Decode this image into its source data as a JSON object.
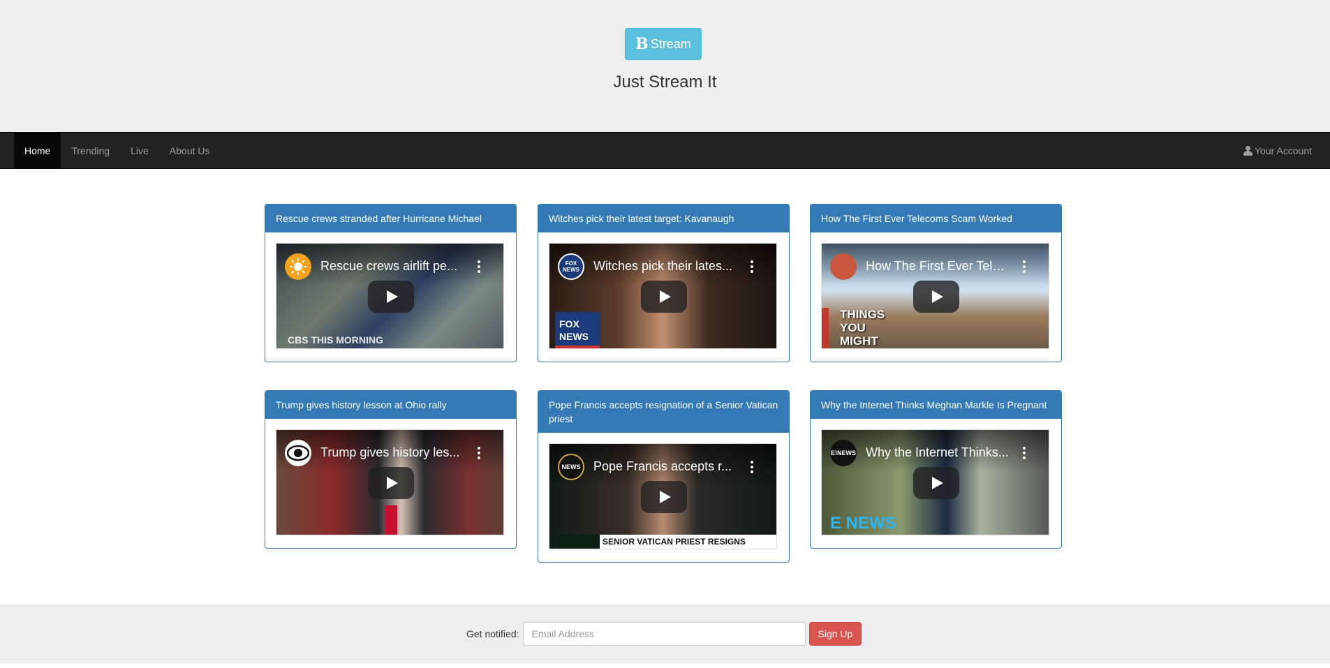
{
  "brand": {
    "logo_mark": "B",
    "logo_label": "Stream",
    "tagline": "Just Stream It"
  },
  "nav": {
    "items": [
      {
        "label": "Home",
        "active": true
      },
      {
        "label": "Trending",
        "active": false
      },
      {
        "label": "Live",
        "active": false
      },
      {
        "label": "About Us",
        "active": false
      }
    ],
    "account_label": "Your Account",
    "account_icon": "user-icon"
  },
  "videos": [
    {
      "heading": "Rescue crews stranded after Hurricane Michael",
      "embed_title": "Rescue crews airlift pe...",
      "channel_mark": "",
      "overlay": "CBS THIS MORNING"
    },
    {
      "heading": "Witches pick their latest target: Kavanaugh",
      "embed_title": "Witches pick their lates...",
      "channel_mark": "FOX NEWS",
      "overlay": "FOX NEWS"
    },
    {
      "heading": "How The First Ever Telecoms Scam Worked",
      "embed_title": "How The First Ever Tele...",
      "channel_mark": "",
      "overlay": "THINGS YOU MIGHT NOT KNOW"
    },
    {
      "heading": "Trump gives history lesson at Ohio rally",
      "embed_title": "Trump gives history les...",
      "channel_mark": "",
      "overlay": ""
    },
    {
      "heading": "Pope Francis accepts resignation of a Senior Vatican priest",
      "embed_title": "Pope Francis accepts r...",
      "channel_mark": "NEWS",
      "overlay": "SENIOR VATICAN PRIEST RESIGNS"
    },
    {
      "heading": "Why the Internet Thinks Meghan Markle Is Pregnant",
      "embed_title": "Why the Internet Thinks...",
      "channel_mark": "E!NEWS",
      "overlay": "E NEWS"
    }
  ],
  "footer": {
    "label": "Get notified:",
    "email_placeholder": "Email Address",
    "signup_label": "Sign Up"
  },
  "colors": {
    "primary": "#337ab7",
    "info": "#5bc0de",
    "danger": "#d9534f",
    "navbar": "#222222"
  }
}
